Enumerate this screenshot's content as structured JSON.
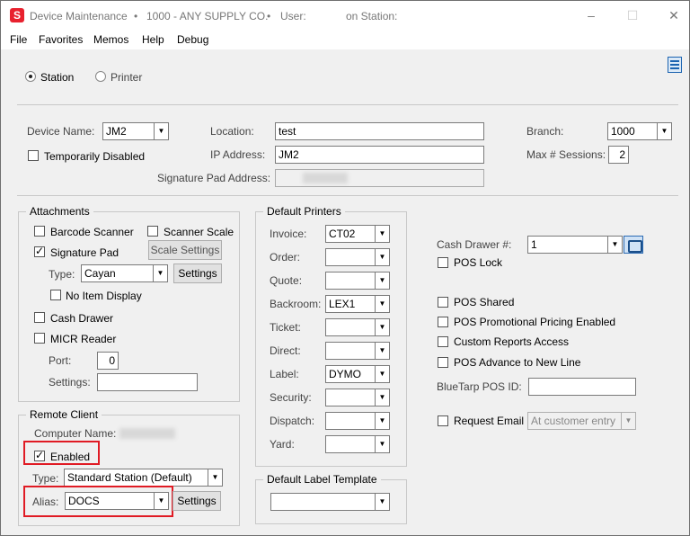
{
  "titlebar": {
    "app_name": "Device Maintenance",
    "company": "1000 - ANY SUPPLY CO.",
    "user_label": "User:",
    "station_label": "on Station:",
    "bullet": "•"
  },
  "menubar": [
    "File",
    "Favorites",
    "Memos",
    "Help",
    "Debug"
  ],
  "mode": {
    "station_label": "Station",
    "printer_label": "Printer",
    "selected": "Station"
  },
  "header": {
    "device_name_label": "Device Name:",
    "device_name_value": "JM2",
    "location_label": "Location:",
    "location_value": "test",
    "branch_label": "Branch:",
    "branch_value": "1000",
    "temporarily_disabled_label": "Temporarily Disabled",
    "ip_address_label": "IP Address:",
    "ip_address_value": "JM2",
    "max_sessions_label": "Max # Sessions:",
    "max_sessions_value": "2",
    "signature_pad_address_label": "Signature Pad Address:"
  },
  "attachments": {
    "title": "Attachments",
    "barcode_scanner_label": "Barcode Scanner",
    "scanner_scale_label": "Scanner Scale",
    "scale_settings_label": "Scale Settings",
    "signature_pad_label": "Signature Pad",
    "type_label": "Type:",
    "type_value": "Cayan",
    "settings_label": "Settings",
    "no_item_display_label": "No Item Display",
    "cash_drawer_label": "Cash Drawer",
    "micr_reader_label": "MICR Reader",
    "port_label": "Port:",
    "port_value": "0",
    "micr_settings_label": "Settings:"
  },
  "remote_client": {
    "title": "Remote Client",
    "computer_name_label": "Computer Name:",
    "enabled_label": "Enabled",
    "type_label": "Type:",
    "type_value": "Standard Station (Default)",
    "alias_label": "Alias:",
    "alias_value": "DOCS",
    "settings_label": "Settings"
  },
  "default_printers": {
    "title": "Default Printers",
    "rows": [
      {
        "label": "Invoice:",
        "value": "CT02"
      },
      {
        "label": "Order:",
        "value": ""
      },
      {
        "label": "Quote:",
        "value": ""
      },
      {
        "label": "Backroom:",
        "value": "LEX1"
      },
      {
        "label": "Ticket:",
        "value": ""
      },
      {
        "label": "Direct:",
        "value": ""
      },
      {
        "label": "Label:",
        "value": "DYMO"
      },
      {
        "label": "Security:",
        "value": ""
      },
      {
        "label": "Dispatch:",
        "value": ""
      },
      {
        "label": "Yard:",
        "value": ""
      }
    ]
  },
  "default_label_template": {
    "title": "Default Label Template",
    "value": ""
  },
  "right_panel": {
    "cash_drawer_num_label": "Cash Drawer #:",
    "cash_drawer_num_value": "1",
    "pos_lock_label": "POS Lock",
    "pos_shared_label": "POS Shared",
    "pos_promotional_label": "POS Promotional Pricing Enabled",
    "custom_reports_label": "Custom Reports Access",
    "pos_advance_label": "POS Advance to New Line",
    "bluetarp_label": "BlueTarp POS ID:",
    "request_email_label": "Request Email",
    "request_email_value": "At customer entry"
  },
  "icons": {
    "app": "app-logo-icon",
    "minimize": "minimize-icon",
    "maximize": "maximize-icon",
    "close": "close-icon",
    "menu": "hamburger-menu-icon",
    "lookup": "lookup-icon"
  },
  "colors": {
    "highlight": "#e01b24",
    "app_icon": "#e8212e",
    "accent": "#1b63b0"
  }
}
